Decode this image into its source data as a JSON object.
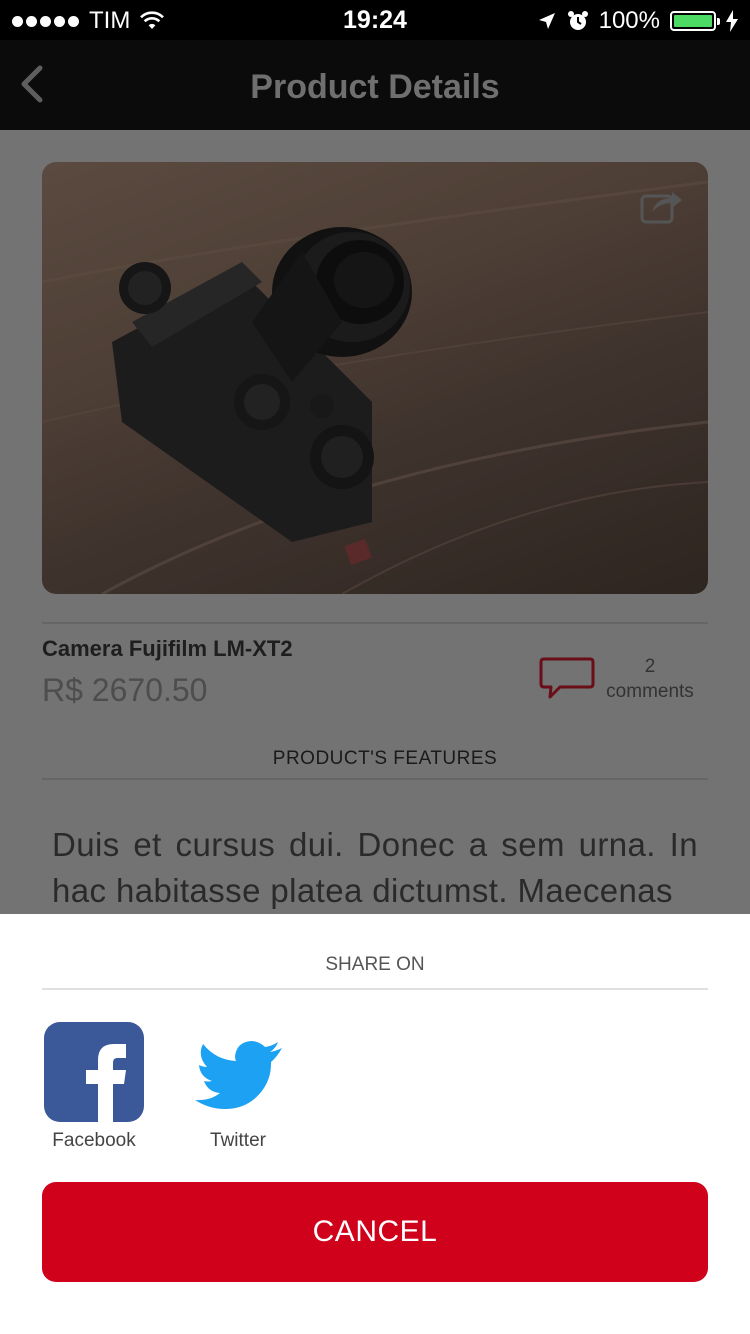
{
  "status_bar": {
    "carrier": "TIM",
    "time": "19:24",
    "battery_percent": "100%",
    "battery_level": 1.0,
    "signal_dots": 5
  },
  "nav": {
    "title": "Product Details",
    "back_icon": "chevron-left-icon"
  },
  "product": {
    "name": "Camera Fujifilm LM-XT2",
    "price": "R$ 2670.50",
    "comments_count": "2",
    "comments_label": "comments",
    "features_label": "PRODUCT'S FEATURES",
    "description": "Duis et cursus dui. Donec a sem urna. In hac habitasse platea dictumst. Maecenas"
  },
  "share_sheet": {
    "heading": "SHARE ON",
    "options": [
      {
        "label": "Facebook",
        "icon": "facebook-icon"
      },
      {
        "label": "Twitter",
        "icon": "twitter-icon"
      }
    ],
    "cancel_label": "CANCEL"
  },
  "colors": {
    "accent": "#d0011b",
    "facebook": "#3b5998",
    "twitter": "#1da1f2",
    "battery": "#4cd964"
  }
}
